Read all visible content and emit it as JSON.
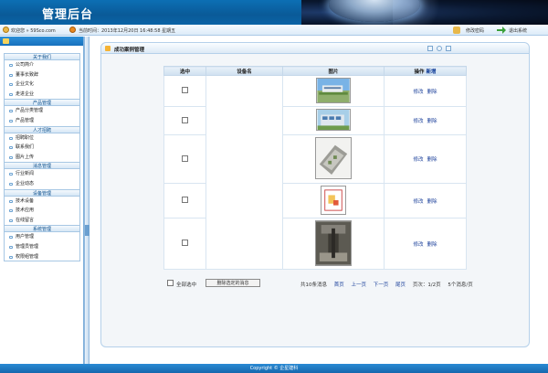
{
  "header": {
    "title": "管理后台"
  },
  "topbar": {
    "welcome": "欢迎您 » 59Sco.com",
    "time": "当前时间：2013年12月20日  16:48:58 星期五",
    "change_password": "修改密码",
    "logout": "退出系统"
  },
  "sidebar": {
    "groups": [
      {
        "title": "关于我们",
        "items": [
          "公司简介",
          "董事长致辞",
          "企业文化",
          "走进企业"
        ]
      },
      {
        "title": "产品管理",
        "items": [
          "产品分类管理",
          "产品管理"
        ]
      },
      {
        "title": "人才招聘",
        "items": [
          "招聘职位",
          "联系我们",
          "图片上传"
        ]
      },
      {
        "title": "消息管理",
        "items": [
          "行业新闻",
          "企业动态"
        ]
      },
      {
        "title": "设备管理",
        "items": [
          "技术设备",
          "技术应用",
          "在线留言"
        ]
      },
      {
        "title": "系统管理",
        "items": [
          "用户管理",
          "管理员管理",
          "权限组管理"
        ]
      }
    ]
  },
  "panel": {
    "title": "成功案例管理",
    "columns": {
      "select": "选中",
      "name": "设备名",
      "image": "图片",
      "action": "操作",
      "add": "新增"
    },
    "rows": [
      {
        "edit": "修改",
        "delete": "删除"
      },
      {
        "edit": "修改",
        "delete": "删除"
      },
      {
        "edit": "修改",
        "delete": "删除"
      },
      {
        "edit": "修改",
        "delete": "删除"
      },
      {
        "edit": "修改",
        "delete": "删除"
      }
    ],
    "footer": {
      "select_all": "全部选中",
      "delete_selected": "删除选定的消息",
      "total": "共10条消息",
      "first": "首页",
      "prev": "上一页",
      "next": "下一页",
      "last": "尾页",
      "page_info": "页次：1/2页",
      "per_page": "5个消息/页"
    }
  },
  "copyright": "Copyright © 企星建科",
  "colors": {
    "header": "#0b63a6",
    "accent": "#1667ad",
    "link": "#1a3f9a"
  }
}
